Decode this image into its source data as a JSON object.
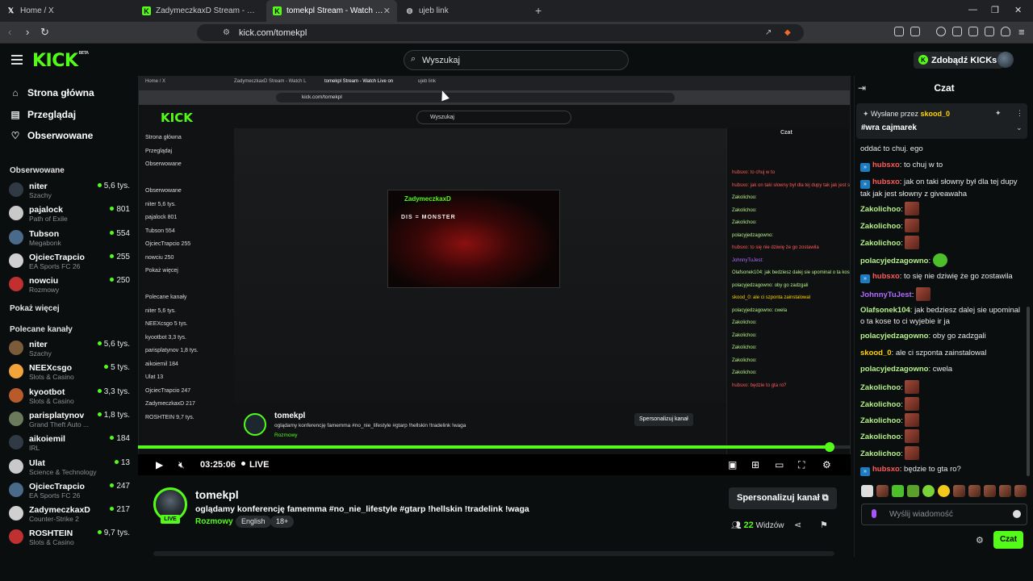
{
  "browser": {
    "tabs": [
      {
        "label": "Home / X",
        "favicon": "x-icon"
      },
      {
        "label": "ZadymeczkaxD Stream - Watch L",
        "favicon": "kick-icon"
      },
      {
        "label": "tomekpl Stream - Watch Live on",
        "favicon": "kick-icon"
      },
      {
        "label": "ujeb link",
        "favicon": "globe-icon"
      }
    ],
    "url": "kick.com/tomekpl"
  },
  "header": {
    "logo": "KICK",
    "logo_sup": "BETA",
    "search_placeholder": "Wyszukaj",
    "kicks_button": "Zdobądź KICKs"
  },
  "sidebar": {
    "nav": [
      {
        "label": "Strona główna",
        "icon": "home-icon"
      },
      {
        "label": "Przeglądaj",
        "icon": "browse-icon"
      },
      {
        "label": "Obserwowane",
        "icon": "heart-icon"
      }
    ],
    "followed_heading": "Obserwowane",
    "followed": [
      {
        "name": "niter",
        "category": "Szachy",
        "viewers": "5,6 tys."
      },
      {
        "name": "pajalock",
        "category": "Path of Exile",
        "viewers": "801"
      },
      {
        "name": "Tubson",
        "category": "Megabonk",
        "viewers": "554"
      },
      {
        "name": "OjciecTrapcio",
        "category": "EA Sports FC 26",
        "viewers": "255"
      },
      {
        "name": "nowciu",
        "category": "Rozmowy",
        "viewers": "250"
      }
    ],
    "show_more": "Pokaż więcej",
    "recommended_heading": "Polecane kanały",
    "recommended": [
      {
        "name": "niter",
        "category": "Szachy",
        "viewers": "5,6 tys."
      },
      {
        "name": "NEEXcsgo",
        "category": "Slots & Casino",
        "viewers": "5 tys."
      },
      {
        "name": "kyootbot",
        "category": "Slots & Casino",
        "viewers": "3,3 tys."
      },
      {
        "name": "parisplatynov",
        "category": "Grand Theft Auto ...",
        "viewers": "1,8 tys."
      },
      {
        "name": "aikoiemil",
        "category": "IRL",
        "viewers": "184"
      },
      {
        "name": "Ulat",
        "category": "Science & Technology",
        "viewers": "13"
      },
      {
        "name": "OjciecTrapcio",
        "category": "EA Sports FC 26",
        "viewers": "247"
      },
      {
        "name": "ZadymeczkaxD",
        "category": "Counter-Strike 2",
        "viewers": "217"
      },
      {
        "name": "ROSHTEIN",
        "category": "Slots & Casino",
        "viewers": "9,7 tys."
      }
    ]
  },
  "player": {
    "time": "03:25:06",
    "live_label": "LIVE",
    "progress_fraction": 0.97,
    "nested_banner": "DIS = MONSTER",
    "nested_brand": "ZadymeczkaxD"
  },
  "stream": {
    "streamer": "tomekpl",
    "live_badge": "LIVE",
    "title": "oglądamy konferencję famemma #no_nie_lifestyle #gtarp !hellskin !tradelink !waga",
    "category": "Rozmowy",
    "tags": [
      "English",
      "18+"
    ],
    "sponsor_button": "Spersonalizuj kanał",
    "viewers_count": "22",
    "viewers_label": "Widzów"
  },
  "chat": {
    "title": "Czat",
    "pinned_prefix": "Wysłane przez",
    "pinned_user": "skood_0",
    "pinned_message": "#wra cajmarek",
    "messages": [
      {
        "user": "",
        "text": "oddać to chuj. ego",
        "color": "#e8e8e8",
        "badge": false,
        "emotes": 0
      },
      {
        "user": "hubsxo",
        "text": ": to chuj w to",
        "color": "#ff5a5a",
        "badge": true,
        "emotes": 0
      },
      {
        "user": "hubsxo",
        "text": ": jak on taki słowny był dla tej dupy tak jak jest słowny z giveawaha",
        "color": "#ff5a5a",
        "badge": true,
        "emotes": 0
      },
      {
        "user": "Zakolichoo",
        "text": ":",
        "color": "#b6f28a",
        "badge": false,
        "emotes": 1
      },
      {
        "user": "Zakolichoo",
        "text": ":",
        "color": "#b6f28a",
        "badge": false,
        "emotes": 1
      },
      {
        "user": "Zakolichoo",
        "text": ":",
        "color": "#b6f28a",
        "badge": false,
        "emotes": 1
      },
      {
        "user": "polacyjedzagowno",
        "text": ":",
        "color": "#b6f28a",
        "badge": false,
        "emotes": 2
      },
      {
        "user": "hubsxo",
        "text": ": to się nie dziwię że go zostawila",
        "color": "#ff5a5a",
        "badge": true,
        "emotes": 0
      },
      {
        "user": "JohnnyTuJest",
        "text": ":",
        "color": "#b06cff",
        "badge": false,
        "emotes": 1
      },
      {
        "user": "Olafsonek104",
        "text": ": jak bedziesz dalej sie upominal o ta kose to ci wyjebie ir ja",
        "color": "#b6f28a",
        "badge": false,
        "emotes": 0
      },
      {
        "user": "polacyjedzagowno",
        "text": ": oby go zadzgali",
        "color": "#b6f28a",
        "badge": false,
        "emotes": 0
      },
      {
        "user": "skood_0",
        "text": ": ale ci szponta zainstalowal",
        "color": "#ffd400",
        "badge": false,
        "emotes": 0
      },
      {
        "user": "polacyjedzagowno",
        "text": ": cwela",
        "color": "#b6f28a",
        "badge": false,
        "emotes": 0
      },
      {
        "user": "Zakolichoo",
        "text": ":",
        "color": "#b6f28a",
        "badge": false,
        "emotes": 1
      },
      {
        "user": "Zakolichoo",
        "text": ":",
        "color": "#b6f28a",
        "badge": false,
        "emotes": 1
      },
      {
        "user": "Zakolichoo",
        "text": ":",
        "color": "#b6f28a",
        "badge": false,
        "emotes": 1
      },
      {
        "user": "Zakolichoo",
        "text": ":",
        "color": "#b6f28a",
        "badge": false,
        "emotes": 1
      },
      {
        "user": "Zakolichoo",
        "text": ":",
        "color": "#b6f28a",
        "badge": false,
        "emotes": 1
      },
      {
        "user": "hubsxo",
        "text": ": będzie to gta ro?",
        "color": "#ff5a5a",
        "badge": true,
        "emotes": 0
      }
    ],
    "input_placeholder": "Wyślij wiadomość",
    "send_button": "Czat"
  },
  "colors": {
    "accent": "#53fc18",
    "background": "#0b0e0f"
  }
}
